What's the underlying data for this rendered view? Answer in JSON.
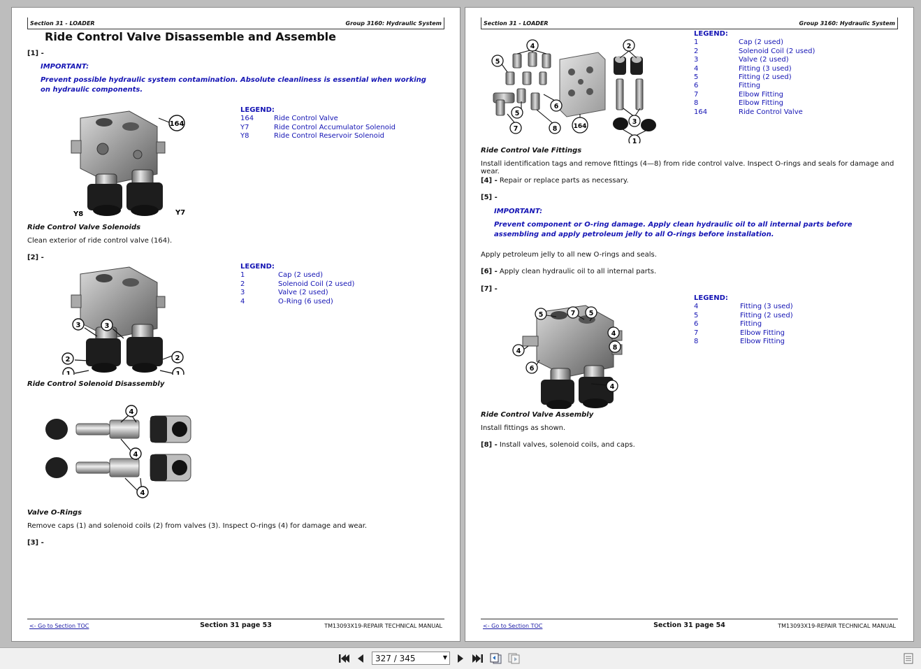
{
  "left_page": {
    "header_left": "Section 31 - LOADER",
    "header_right": "Group 3160: Hydraulic System",
    "title": "Ride Control Valve Disassemble and Assemble",
    "step1": "[1] -",
    "important_label": "IMPORTANT:",
    "important_text": "Prevent possible hydraulic system contamination. Absolute cleanliness is essential when working on hydraulic components.",
    "legend1": {
      "title": "LEGEND:",
      "items": [
        {
          "key": "164",
          "value": "Ride Control Valve"
        },
        {
          "key": "Y7",
          "value": "Ride Control Accumulator Solenoid"
        },
        {
          "key": "Y8",
          "value": "Ride Control Reservoir Solenoid"
        }
      ]
    },
    "fig1_labels": {
      "a": "164",
      "b": "Y8",
      "c": "Y7"
    },
    "caption1": "Ride Control Valve Solenoids",
    "text1": "Clean exterior of ride control valve (164).",
    "step2": "[2] -",
    "legend2": {
      "title": "LEGEND:",
      "items": [
        {
          "key": "1",
          "value": "Cap (2 used)"
        },
        {
          "key": "2",
          "value": "Solenoid Coil (2 used)"
        },
        {
          "key": "3",
          "value": "Valve (2 used)"
        },
        {
          "key": "4",
          "value": "O-Ring (6 used)"
        }
      ]
    },
    "fig2_labels": {
      "one": "1",
      "two": "2",
      "three": "3"
    },
    "caption2": "Ride Control Solenoid Disassembly",
    "fig3_labels": {
      "four": "4"
    },
    "caption3": "Valve O-Rings",
    "text2": "Remove caps (1) and solenoid coils (2) from valves (3). Inspect O-rings (4) for damage and wear.",
    "step3": "[3] -",
    "footer_toc": "<- Go to Section TOC",
    "footer_page": "Section 31 page 53",
    "footer_manual": "TM13093X19-REPAIR TECHNICAL MANUAL"
  },
  "right_page": {
    "header_left": "Section 31 - LOADER",
    "header_right": "Group 3160: Hydraulic System",
    "legend1": {
      "title": "LEGEND:",
      "items": [
        {
          "key": "1",
          "value": "Cap (2 used)"
        },
        {
          "key": "2",
          "value": "Solenoid Coil (2 used)"
        },
        {
          "key": "3",
          "value": "Valve (2 used)"
        },
        {
          "key": "4",
          "value": "Fitting (3 used)"
        },
        {
          "key": "5",
          "value": "Fitting (2 used)"
        },
        {
          "key": "6",
          "value": "Fitting"
        },
        {
          "key": "7",
          "value": "Elbow Fitting"
        },
        {
          "key": "8",
          "value": "Elbow Fitting"
        },
        {
          "key": "164",
          "value": "Ride Control Valve"
        }
      ]
    },
    "fig1_labels": {
      "one": "1",
      "two": "2",
      "three": "3",
      "four": "4",
      "five": "5",
      "six": "6",
      "seven": "7",
      "eight": "8",
      "valve": "164"
    },
    "caption1": "Ride Control Vale Fittings",
    "text1": "Install identification tags and remove fittings (4—8) from ride control valve. Inspect O-rings and seals for damage and wear.",
    "step4_num": "[4] -",
    "step4_text": "Repair or replace parts as necessary.",
    "step5": "[5] -",
    "important_label": "IMPORTANT:",
    "important_text": "Prevent component or O-ring damage. Apply clean hydraulic oil to all internal parts before assembling and apply petroleum jelly to all O-rings before installation.",
    "text2": "Apply petroleum jelly to all new O-rings and seals.",
    "step6_num": "[6] -",
    "step6_text": "Apply clean hydraulic oil to all internal parts.",
    "step7": "[7] -",
    "legend2": {
      "title": "LEGEND:",
      "items": [
        {
          "key": "4",
          "value": "Fitting (3 used)"
        },
        {
          "key": "5",
          "value": "Fitting (2 used)"
        },
        {
          "key": "6",
          "value": "Fitting"
        },
        {
          "key": "7",
          "value": "Elbow Fitting"
        },
        {
          "key": "8",
          "value": "Elbow Fitting"
        }
      ]
    },
    "fig2_labels": {
      "four": "4",
      "five": "5",
      "six": "6",
      "seven": "7",
      "eight": "8"
    },
    "caption2": "Ride Control Valve Assembly",
    "text3": "Install fittings as shown.",
    "step8_num": "[8] -",
    "step8_text": "Install valves, solenoid coils, and caps.",
    "footer_toc": "<- Go to Section TOC",
    "footer_page": "Section 31 page 54",
    "footer_manual": "TM13093X19-REPAIR TECHNICAL MANUAL"
  },
  "toolbar": {
    "page_indicator": "327 / 345",
    "icons": [
      "first-page-icon",
      "prev-page-icon",
      "next-page-icon",
      "last-page-icon",
      "single-page-view-icon",
      "two-page-view-icon",
      "sidebar-toggle-icon"
    ]
  }
}
